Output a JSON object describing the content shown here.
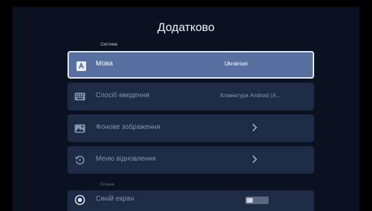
{
  "page": {
    "title": "Додатково"
  },
  "sections": {
    "system": "Система",
    "more": "Більше"
  },
  "rows": [
    {
      "icon": "language-icon",
      "label": "Мова",
      "value": "Ukrainian"
    },
    {
      "icon": "keyboard-icon",
      "label": "Спосіб введення",
      "value": "Клавіатура Android (A..."
    },
    {
      "icon": "wallpaper-icon",
      "label": "Фонове зображення"
    },
    {
      "icon": "recovery-icon",
      "label": "Меню відновлення"
    },
    {
      "icon": "blue-screen-icon",
      "label": "Синій екран",
      "toggle_on": false
    }
  ],
  "colors": {
    "background": "#0a1222",
    "row": "#1d2b45",
    "row_focused": "#56719f",
    "text_dim": "#8794ac"
  }
}
